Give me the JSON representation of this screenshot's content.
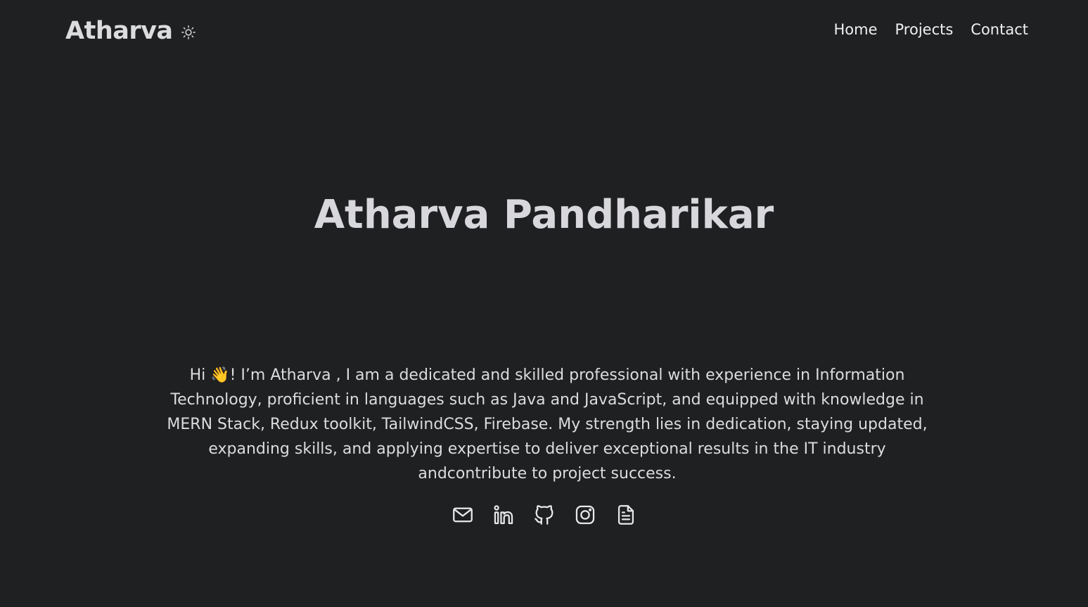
{
  "header": {
    "brand": "Atharva",
    "theme_toggle_icon": "sun-icon",
    "nav": [
      {
        "label": "Home"
      },
      {
        "label": "Projects"
      },
      {
        "label": "Contact"
      }
    ]
  },
  "hero": {
    "title": "Atharva Pandharikar",
    "intro": "Hi 👋! I’m Atharva , I am a dedicated and skilled professional with experience in Information Technology, proficient in languages such as Java and JavaScript, and equipped with knowledge in MERN Stack, Redux toolkit, TailwindCSS, Firebase. My strength lies in dedication, staying updated, expanding skills, and applying expertise to deliver exceptional results in the IT industry andcontribute to project success."
  },
  "social": [
    {
      "icon": "mail-icon"
    },
    {
      "icon": "linkedin-icon"
    },
    {
      "icon": "github-icon"
    },
    {
      "icon": "instagram-icon"
    },
    {
      "icon": "resume-icon"
    }
  ],
  "colors": {
    "background": "#1f2022",
    "text": "#e6e6e8"
  }
}
